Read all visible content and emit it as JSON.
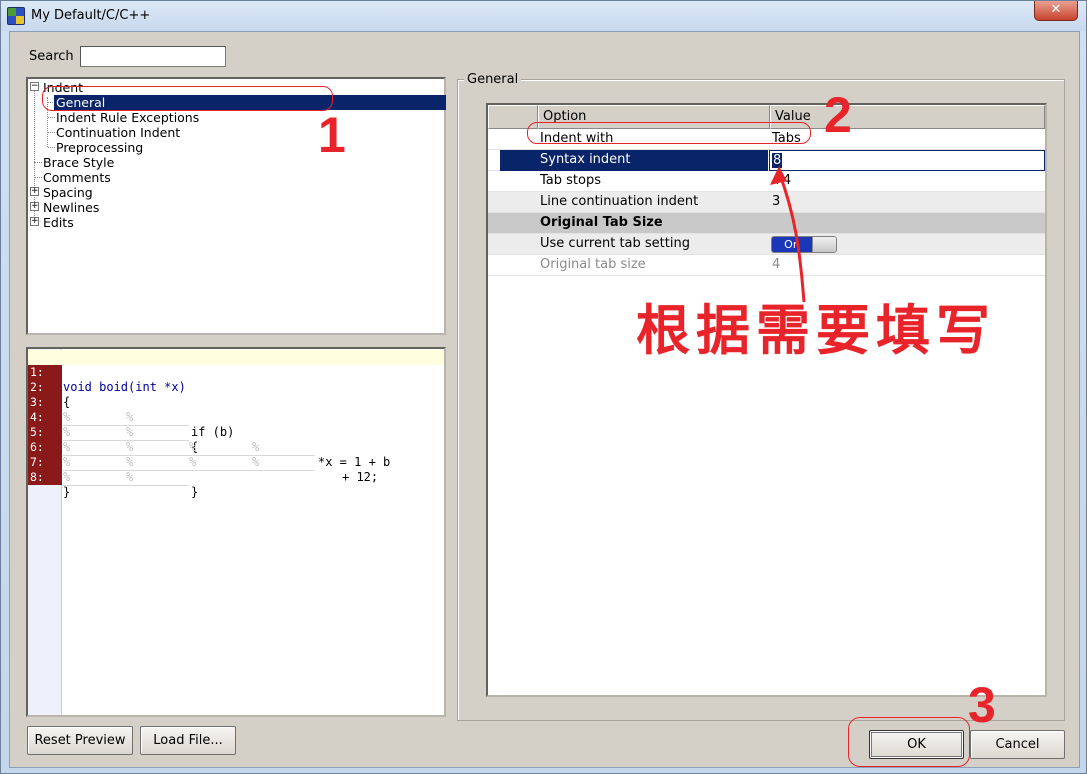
{
  "window": {
    "title": "My Default/C/C++",
    "close_glyph": "✕"
  },
  "search": {
    "label": "Search",
    "value": ""
  },
  "tree": {
    "items": [
      {
        "label": "Indent",
        "expander": "⊟"
      },
      {
        "label": "General"
      },
      {
        "label": "Indent Rule Exceptions"
      },
      {
        "label": "Continuation Indent"
      },
      {
        "label": "Preprocessing"
      },
      {
        "label": "Brace Style"
      },
      {
        "label": "Comments"
      },
      {
        "label": "Spacing",
        "expander": "⊞"
      },
      {
        "label": "Newlines",
        "expander": "⊞"
      },
      {
        "label": "Edits",
        "expander": "⊞"
      }
    ],
    "selected": "General"
  },
  "preview": {
    "lines": [
      {
        "num": "1:",
        "text": "void boid(int *x)"
      },
      {
        "num": "2:",
        "text": "{"
      },
      {
        "num": "3:",
        "text": "if (b)"
      },
      {
        "num": "4:",
        "text": "{"
      },
      {
        "num": "5:",
        "text": "*x = 1 + b"
      },
      {
        "num": "6:",
        "text": "+ 12;"
      },
      {
        "num": "7:",
        "text": "}"
      },
      {
        "num": "8:",
        "text": "}"
      }
    ],
    "tab_glyph": "%"
  },
  "buttons": {
    "reset_preview": "Reset Preview",
    "load_file": "Load File...",
    "ok": "OK",
    "cancel": "Cancel"
  },
  "general_group": {
    "legend": "General",
    "columns": {
      "option": "Option",
      "value": "Value"
    },
    "rows": [
      {
        "option": "Indent with",
        "value": "Tabs"
      },
      {
        "option": "Syntax indent",
        "value": "8"
      },
      {
        "option": "Tab stops",
        "value": "+4"
      },
      {
        "option": "Line continuation indent",
        "value": "3"
      },
      {
        "option": "Original Tab Size",
        "value": ""
      },
      {
        "option": "Use current tab setting",
        "value": "On"
      },
      {
        "option": "Original tab size",
        "value": "4"
      }
    ]
  },
  "annotations": {
    "n1": "1",
    "n2": "2",
    "n3": "3",
    "note": "根据需要填写"
  },
  "colors": {
    "selection": "#0a246a",
    "annotation_red": "#e8242a",
    "gutter_red": "#8a1a1a"
  }
}
